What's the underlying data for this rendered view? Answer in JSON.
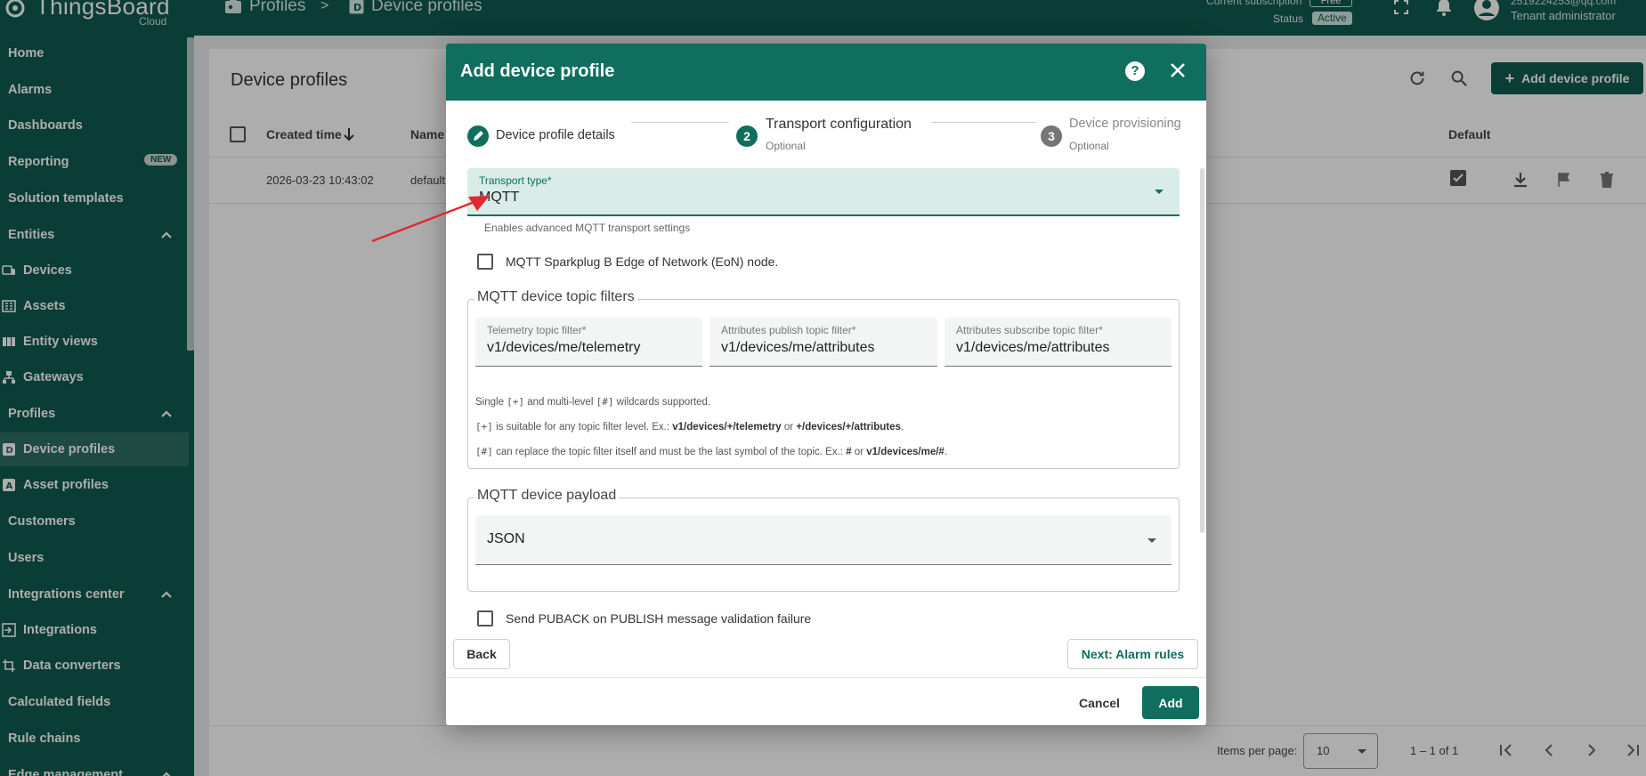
{
  "app": {
    "name": "ThingsBoard",
    "edition": "Cloud",
    "breadcrumb": [
      "Profiles",
      "Device profiles"
    ],
    "breadcrumb_separator": ">",
    "subscription_label": "Current subscription",
    "subscription_value": "Free",
    "status_label": "Status",
    "status_value": "Active",
    "user_email": "2519224253@qq.com",
    "user_role": "Tenant administrator"
  },
  "sidebar": {
    "items": [
      {
        "label": "Home"
      },
      {
        "label": "Alarms"
      },
      {
        "label": "Dashboards"
      },
      {
        "label": "Reporting",
        "badge": "NEW"
      },
      {
        "label": "Solution templates"
      },
      {
        "label": "Entities"
      },
      {
        "label": "Devices"
      },
      {
        "label": "Assets"
      },
      {
        "label": "Entity views"
      },
      {
        "label": "Gateways"
      },
      {
        "label": "Profiles"
      },
      {
        "label": "Device profiles"
      },
      {
        "label": "Asset profiles"
      },
      {
        "label": "Customers"
      },
      {
        "label": "Users"
      },
      {
        "label": "Integrations center"
      },
      {
        "label": "Integrations"
      },
      {
        "label": "Data converters"
      },
      {
        "label": "Calculated fields"
      },
      {
        "label": "Rule chains"
      },
      {
        "label": "Edge management"
      }
    ]
  },
  "main": {
    "title": "Device profiles",
    "add_button": "Add device profile",
    "columns": {
      "created": "Created time",
      "name": "Name",
      "default": "Default"
    },
    "rows": [
      {
        "created": "2026-03-23 10:43:02",
        "name": "default"
      }
    ],
    "items_per_page_label": "Items per page:",
    "items_per_page": "10",
    "range": "1 – 1 of 1"
  },
  "dialog": {
    "title": "Add device profile",
    "steps": [
      {
        "num": "",
        "label": "Device profile details",
        "sub": ""
      },
      {
        "num": "2",
        "label": "Transport configuration",
        "sub": "Optional"
      },
      {
        "num": "3",
        "label": "Device provisioning",
        "sub": "Optional"
      }
    ],
    "transport_type_label": "Transport type*",
    "transport_type_value": "MQTT",
    "transport_hint": "Enables advanced MQTT transport settings",
    "sparkplug_label": "MQTT Sparkplug B Edge of Network (EoN) node.",
    "topic_filters_legend": "MQTT device topic filters",
    "telemetry_label": "Telemetry topic filter*",
    "telemetry_value": "v1/devices/me/telemetry",
    "attr_pub_label": "Attributes publish topic filter*",
    "attr_pub_value": "v1/devices/me/attributes",
    "attr_sub_label": "Attributes subscribe topic filter*",
    "attr_sub_value": "v1/devices/me/attributes",
    "note1_a": "Single ",
    "note1_b": "[+]",
    "note1_c": " and multi-level ",
    "note1_d": "[#]",
    "note1_e": " wildcards supported.",
    "note2_a": "[+]",
    "note2_b": " is suitable for any topic filter level. Ex.: ",
    "note2_c": "v1/devices/+/telemetry",
    "note2_d": " or ",
    "note2_e": "+/devices/+/attributes",
    "note2_f": ".",
    "note3_a": "[#]",
    "note3_b": " can replace the topic filter itself and must be the last symbol of the topic. Ex.: ",
    "note3_c": "#",
    "note3_d": " or ",
    "note3_e": "v1/devices/me/#",
    "note3_f": ".",
    "payload_legend": "MQTT device payload",
    "payload_value": "JSON",
    "puback_label": "Send PUBACK on PUBLISH message validation failure",
    "back_button": "Back",
    "next_button": "Next: Alarm rules",
    "cancel_button": "Cancel",
    "add_button": "Add"
  },
  "colors": {
    "brand": "#0f5a4e",
    "accent": "#0f6e5d",
    "annotation_arrow": "#e0282e"
  }
}
